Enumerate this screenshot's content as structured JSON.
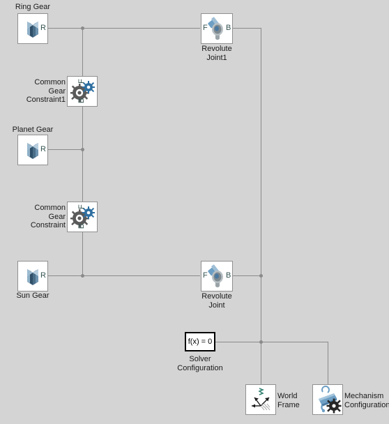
{
  "diagram": {
    "background_color": "#d4d4d4",
    "wire_color": "#8a8a8a",
    "accent_color": "#5b86ab",
    "port_label_color": "#33524f"
  },
  "blocks": {
    "ring_gear": {
      "label": "Ring Gear",
      "icon": "gear-solid-icon",
      "port_r": "R"
    },
    "planet_gear": {
      "label": "Planet Gear",
      "icon": "gear-solid-icon",
      "port_r": "R"
    },
    "sun_gear": {
      "label": "Sun Gear",
      "icon": "gear-solid-icon",
      "port_r": "R"
    },
    "common_gear_constraint1": {
      "label": "Common\nGear\nConstraint1",
      "icon": "common-gear-constraint-icon",
      "port_f": "F",
      "port_b": "B"
    },
    "common_gear_constraint": {
      "label": "Common\nGear\nConstraint",
      "icon": "common-gear-constraint-icon",
      "port_f": "F",
      "port_b": "B"
    },
    "revolute_joint1": {
      "label": "Revolute\nJoint1",
      "icon": "revolute-joint-icon",
      "port_f": "F",
      "port_b": "B"
    },
    "revolute_joint": {
      "label": "Revolute\nJoint",
      "icon": "revolute-joint-icon",
      "port_f": "F",
      "port_b": "B"
    },
    "solver_configuration": {
      "label": "Solver\nConfiguration",
      "text": "f(x) = 0"
    },
    "world_frame": {
      "label": "World\nFrame",
      "icon": "world-frame-icon"
    },
    "mechanism_configuration": {
      "label": "Mechanism\nConfiguration",
      "icon": "mechanism-configuration-icon"
    }
  }
}
